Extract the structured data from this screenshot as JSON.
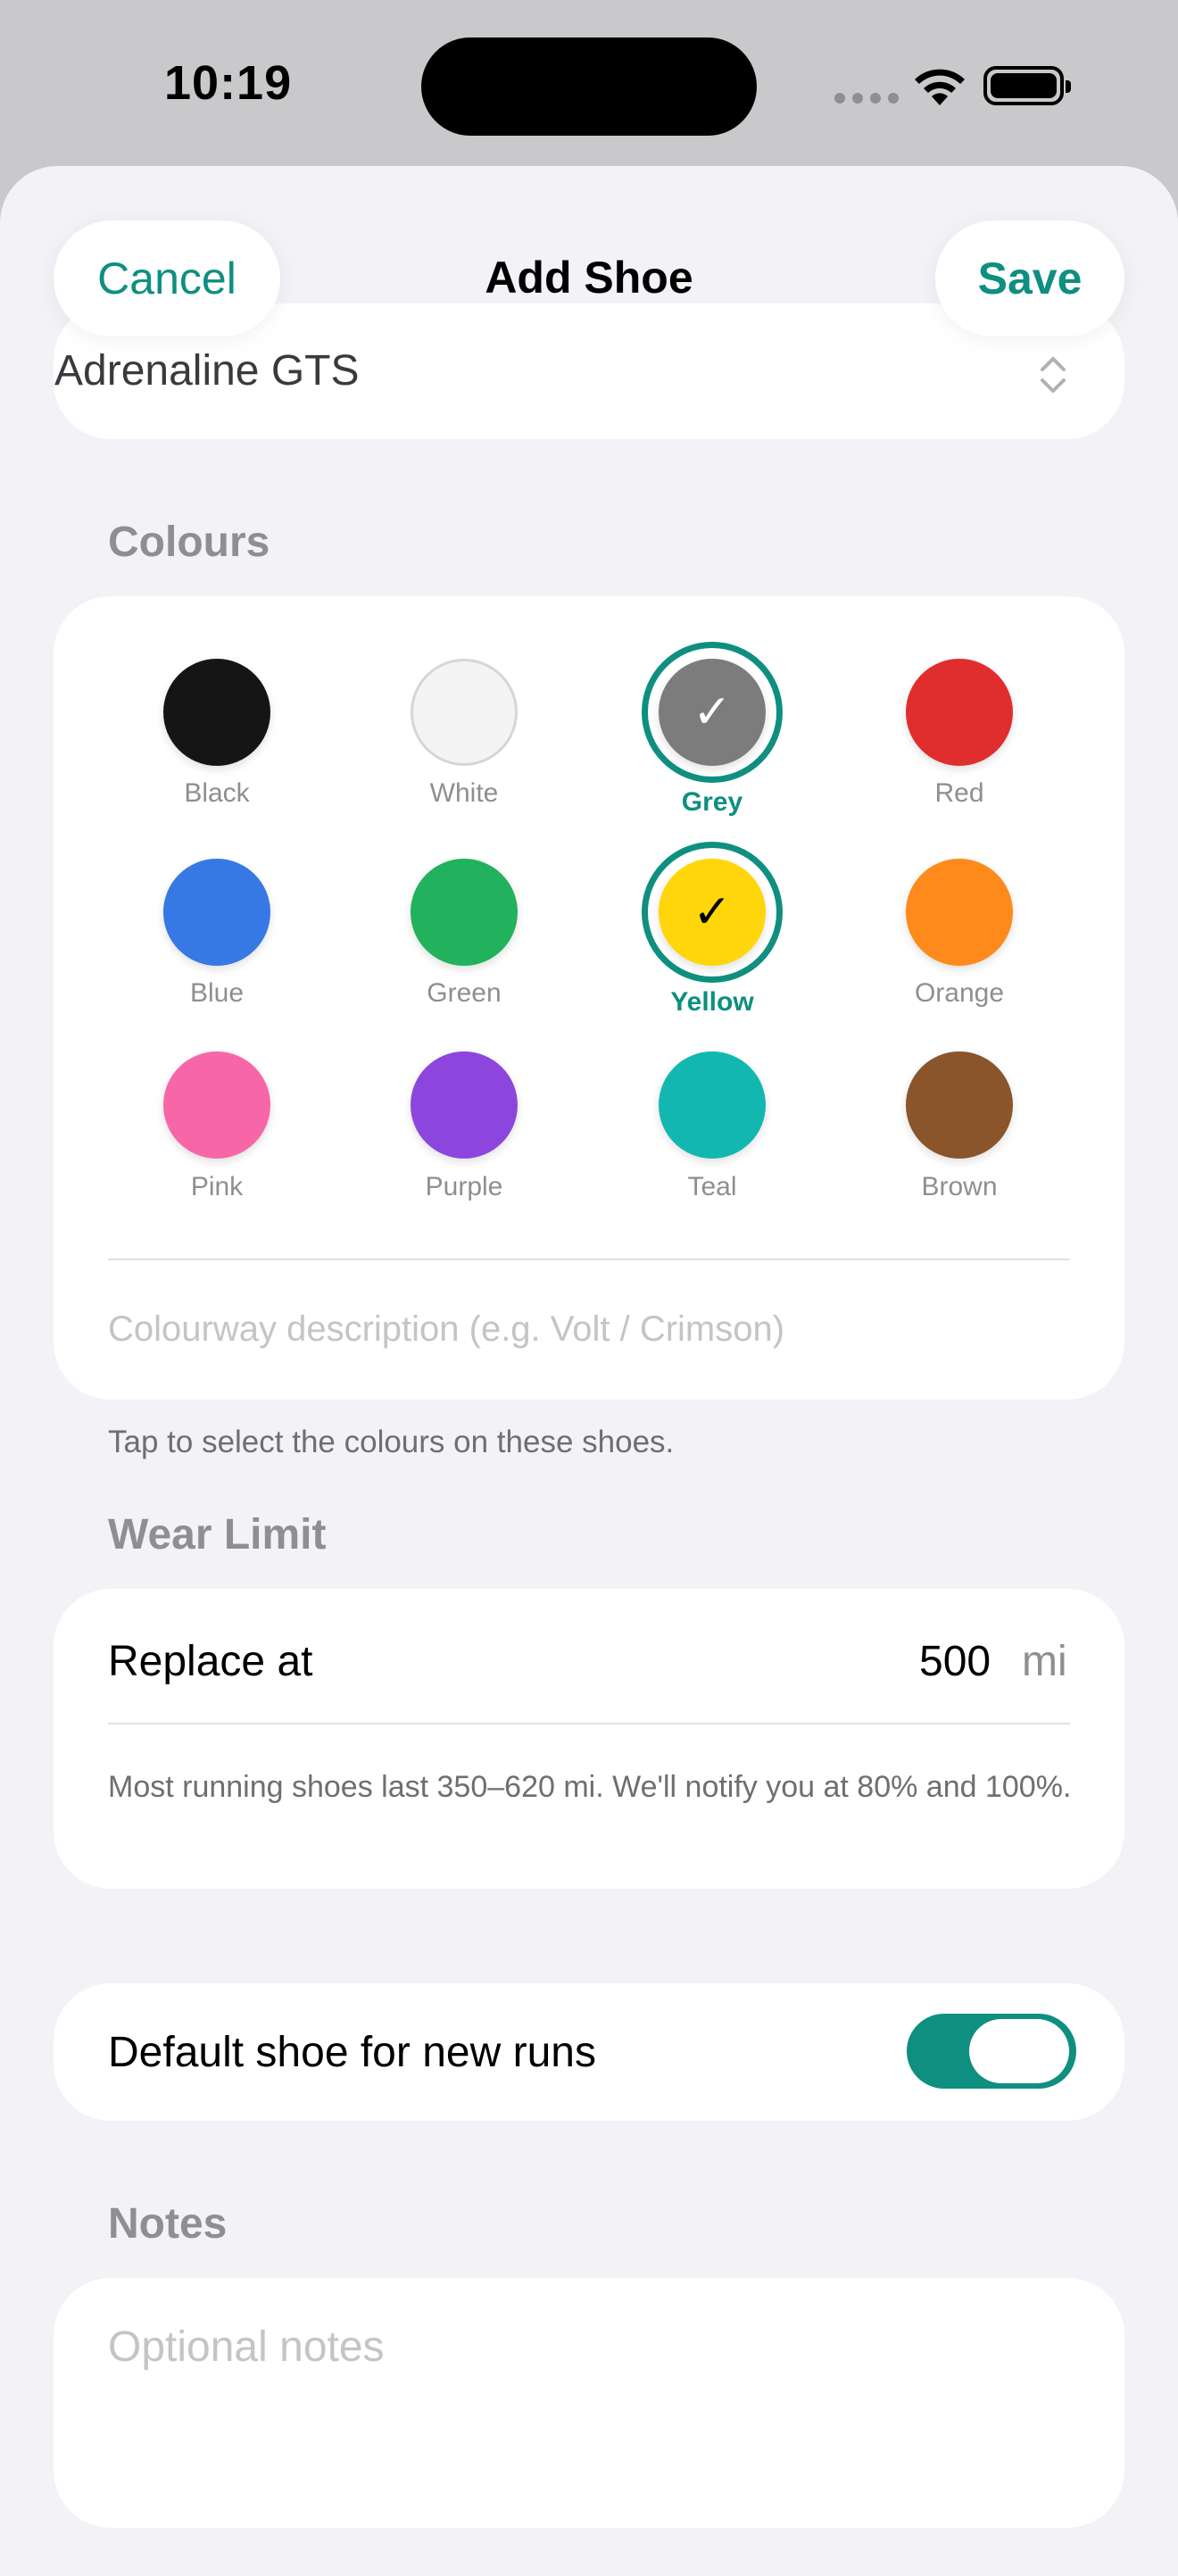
{
  "status_bar": {
    "time": "10:19"
  },
  "header": {
    "cancel_label": "Cancel",
    "title": "Add Shoe",
    "save_label": "Save"
  },
  "model": {
    "value": "Adrenaline GTS"
  },
  "colours": {
    "section_label": "Colours",
    "swatches": [
      {
        "name": "Black",
        "color": "#151515",
        "selected": false
      },
      {
        "name": "White",
        "color": "#f4f4f4",
        "selected": false
      },
      {
        "name": "Grey",
        "color": "#7c7c7c",
        "selected": true
      },
      {
        "name": "Red",
        "color": "#e02e2e",
        "selected": false
      },
      {
        "name": "Blue",
        "color": "#3679e4",
        "selected": false
      },
      {
        "name": "Green",
        "color": "#22b15d",
        "selected": false
      },
      {
        "name": "Yellow",
        "color": "#ffd60a",
        "selected": true
      },
      {
        "name": "Orange",
        "color": "#ff8a1c",
        "selected": false
      },
      {
        "name": "Pink",
        "color": "#f767a8",
        "selected": false
      },
      {
        "name": "Purple",
        "color": "#8c46dd",
        "selected": false
      },
      {
        "name": "Teal",
        "color": "#12b8b0",
        "selected": false
      },
      {
        "name": "Brown",
        "color": "#8a552a",
        "selected": false
      }
    ],
    "description_placeholder": "Colourway description (e.g. Volt / Crimson)",
    "footnote": "Tap to select the colours on these shoes."
  },
  "wear_limit": {
    "section_label": "Wear Limit",
    "replace_label": "Replace at",
    "replace_value": "500",
    "replace_unit": "mi",
    "note": "Most running shoes last 350–620 mi. We'll notify you at 80% and 100%."
  },
  "default_shoe": {
    "label": "Default shoe for new runs",
    "enabled": true
  },
  "notes": {
    "section_label": "Notes",
    "placeholder": "Optional notes"
  },
  "theme": {
    "accent": "#0e8f80",
    "background": "#f2f2f7"
  }
}
